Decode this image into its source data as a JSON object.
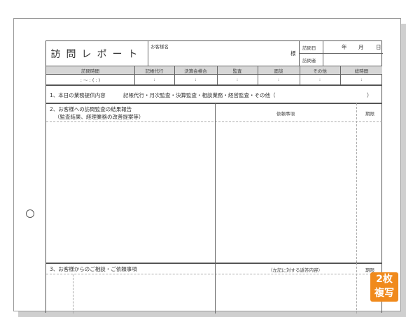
{
  "header": {
    "title": "訪問レポート",
    "customer_label": "お客様名",
    "sama": "様",
    "visit_date_label": "訪問日",
    "year": "年",
    "month": "月",
    "day": "日",
    "visitor_label": "訪問者"
  },
  "columns": [
    {
      "label": "訪問時間",
      "value": ":  〜  :  (  :  )"
    },
    {
      "label": "記帳代行",
      "value": ":"
    },
    {
      "label": "決算会検合",
      "value": ":"
    },
    {
      "label": "監査",
      "value": ":"
    },
    {
      "label": "面談",
      "value": ":"
    },
    {
      "label": "その他",
      "value": ":"
    },
    {
      "label": "総時間",
      "value": ":"
    }
  ],
  "section1": {
    "label": "1、本日の業務提供内容",
    "items": "記帳代行・月次監査・決算監査・相談業務・経営監査・その他（",
    "close": "）"
  },
  "section2": {
    "label": "2、お客様への訪問監査の結果報告",
    "sublabel": "（監査結果、経理業務の改善提案等）",
    "col_request": "依頼事項",
    "col_deadline": "期限"
  },
  "section3": {
    "label": "3、お客様からのご相談・ご依頼事項",
    "col_answer": "（左記に対する返答内容）",
    "col_deadline": "期限"
  },
  "badge": {
    "line1": "2枚",
    "line2": "複写",
    "color": "#f08a1c"
  }
}
